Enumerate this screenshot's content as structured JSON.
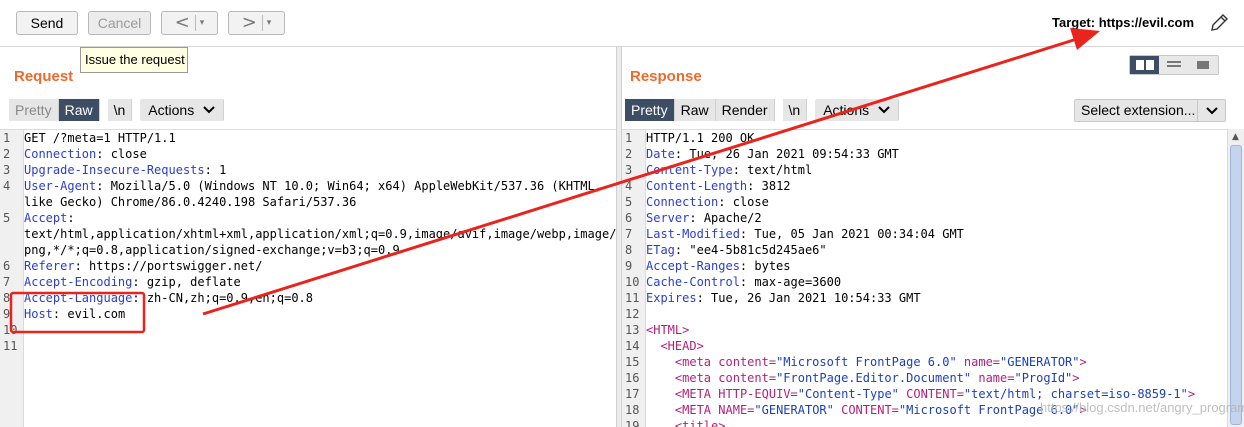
{
  "toolbar": {
    "send_label": "Send",
    "cancel_label": "Cancel",
    "back_label": "<",
    "forward_label": ">",
    "dropdown_glyph": "▾",
    "target_label": "Target: https://evil.com",
    "tooltip": "Issue the request"
  },
  "request": {
    "title": "Request",
    "tabs": [
      "Pretty",
      "Raw",
      "\\n"
    ],
    "active_tab": "Raw",
    "actions_label": "Actions",
    "lines": [
      {
        "n": "1",
        "k": "",
        "v": "GET /?meta=1 HTTP/1.1"
      },
      {
        "n": "2",
        "k": "Connection",
        "v": " close"
      },
      {
        "n": "3",
        "k": "Upgrade-Insecure-Requests",
        "v": " 1"
      },
      {
        "n": "4",
        "k": "User-Agent",
        "v": " Mozilla/5.0 (Windows NT 10.0; Win64; x64) AppleWebKit/537.36 (KHTML,"
      },
      {
        "n": "",
        "k": "",
        "v": "like Gecko) Chrome/86.0.4240.198 Safari/537.36"
      },
      {
        "n": "5",
        "k": "Accept",
        "v": ""
      },
      {
        "n": "",
        "k": "",
        "v": "text/html,application/xhtml+xml,application/xml;q=0.9,image/avif,image/webp,image/a"
      },
      {
        "n": "",
        "k": "",
        "v": "png,*/*;q=0.8,application/signed-exchange;v=b3;q=0.9"
      },
      {
        "n": "6",
        "k": "Referer",
        "v": " https://portswigger.net/"
      },
      {
        "n": "7",
        "k": "Accept-Encoding",
        "v": " gzip, deflate"
      },
      {
        "n": "8",
        "k": "Accept-Language",
        "v": " zh-CN,zh;q=0.9,en;q=0.8"
      },
      {
        "n": "9",
        "k": "Host",
        "v": " evil.com"
      },
      {
        "n": "10",
        "k": "",
        "v": ""
      },
      {
        "n": "11",
        "k": "",
        "v": ""
      }
    ]
  },
  "response": {
    "title": "Response",
    "tabs": [
      "Pretty",
      "Raw",
      "Render",
      "\\n"
    ],
    "active_tab": "Pretty",
    "actions_label": "Actions",
    "select_extension": "Select extension...",
    "lines": [
      {
        "n": "1",
        "k": "",
        "v": "HTTP/1.1 200 OK"
      },
      {
        "n": "2",
        "k": "Date",
        "v": " Tue, 26 Jan 2021 09:54:33 GMT"
      },
      {
        "n": "3",
        "k": "Content-Type",
        "v": " text/html"
      },
      {
        "n": "4",
        "k": "Content-Length",
        "v": " 3812"
      },
      {
        "n": "5",
        "k": "Connection",
        "v": " close"
      },
      {
        "n": "6",
        "k": "Server",
        "v": " Apache/2"
      },
      {
        "n": "7",
        "k": "Last-Modified",
        "v": " Tue, 05 Jan 2021 00:34:04 GMT"
      },
      {
        "n": "8",
        "k": "ETag",
        "v": " \"ee4-5b81c5d245ae6\""
      },
      {
        "n": "9",
        "k": "Accept-Ranges",
        "v": " bytes"
      },
      {
        "n": "10",
        "k": "Cache-Control",
        "v": " max-age=3600"
      },
      {
        "n": "11",
        "k": "Expires",
        "v": " Tue, 26 Jan 2021 10:54:33 GMT"
      },
      {
        "n": "12",
        "k": "",
        "v": ""
      },
      {
        "n": "13",
        "html": [
          [
            "tag",
            "<HTML>"
          ]
        ]
      },
      {
        "n": "14",
        "html": [
          [
            "pad",
            "  "
          ],
          [
            "tag",
            "<HEAD>"
          ]
        ]
      },
      {
        "n": "15",
        "html": [
          [
            "pad",
            "    "
          ],
          [
            "tag",
            "<meta "
          ],
          [
            "att",
            "content="
          ],
          [
            "str",
            "\"Microsoft FrontPage 6.0\" "
          ],
          [
            "att",
            "name="
          ],
          [
            "str",
            "\"GENERATOR\""
          ],
          [
            "tag",
            ">"
          ]
        ]
      },
      {
        "n": "16",
        "html": [
          [
            "pad",
            "    "
          ],
          [
            "tag",
            "<meta "
          ],
          [
            "att",
            "content="
          ],
          [
            "str",
            "\"FrontPage.Editor.Document\" "
          ],
          [
            "att",
            "name="
          ],
          [
            "str",
            "\"ProgId\""
          ],
          [
            "tag",
            ">"
          ]
        ]
      },
      {
        "n": "17",
        "html": [
          [
            "pad",
            "    "
          ],
          [
            "tag",
            "<META "
          ],
          [
            "att",
            "HTTP-EQUIV="
          ],
          [
            "str",
            "\"Content-Type\" "
          ],
          [
            "att",
            "CONTENT="
          ],
          [
            "str",
            "\"text/html; charset=iso-8859-1\""
          ],
          [
            "tag",
            ">"
          ]
        ]
      },
      {
        "n": "18",
        "html": [
          [
            "pad",
            "    "
          ],
          [
            "tag",
            "<META "
          ],
          [
            "att",
            "NAME="
          ],
          [
            "str",
            "\"GENERATOR\" "
          ],
          [
            "att",
            "CONTENT="
          ],
          [
            "str",
            "\"Microsoft FrontPage 6.0\""
          ],
          [
            "tag",
            ">"
          ]
        ]
      },
      {
        "n": "19",
        "html": [
          [
            "pad",
            "    "
          ],
          [
            "tag",
            "<title>"
          ]
        ]
      }
    ]
  },
  "watermark": "https://blog.csdn.net/angry_program",
  "colors": {
    "accent": "#ea6b2d",
    "active_tab": "#3d4d63",
    "annotation": "#e8241c",
    "header_key": "#2a3ecf",
    "html_tag": "#b51f7a"
  }
}
